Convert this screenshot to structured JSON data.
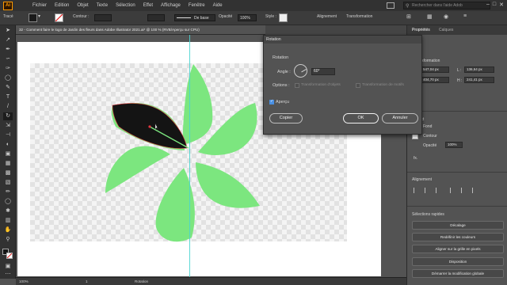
{
  "app": {
    "logo": "Ai"
  },
  "menu": [
    "Fichier",
    "Edition",
    "Objet",
    "Texte",
    "Sélection",
    "Effet",
    "Affichage",
    "Fenêtre",
    "Aide"
  ],
  "search": {
    "placeholder": "Rechercher dans l'aide Adob"
  },
  "controlbar": {
    "type_label": "Tracé",
    "contour_label": "Contour :",
    "stroke_style": "De base",
    "opacity_label": "Opacité",
    "opacity_value": "100%",
    "style_label": "Style :",
    "alignement_label": "Alignement",
    "transformation_label": "Transformation"
  },
  "document": {
    "tab_title": "32 - Comment faire le logo de Jardin des fleurs dans Adobe Illustrator 2021.ai* @ 100 % (RVB/Aperçu sur CPU)"
  },
  "status": {
    "zoom": "100%",
    "page": "1",
    "tool": "Rotation"
  },
  "dialog": {
    "title": "Rotation",
    "section": "Rotation",
    "angle_label": "Angle :",
    "angle_value": "60°",
    "options_label": "Options :",
    "opt_objects": "Transformation d'objets",
    "opt_patterns": "Transformation de motifs",
    "preview_label": "Aperçu",
    "preview_checked": true,
    "copy_button": "Copier",
    "ok_button": "OK",
    "cancel_button": "Annuler"
  },
  "panel": {
    "tabs": [
      "Propriétés",
      "Calques"
    ],
    "transform_heading": "Transformation",
    "x_label": "X :",
    "x_value": "547,04 px",
    "y_label": "Y :",
    "y_value": "404,70 px",
    "l_label": "L :",
    "l_value": "136,64 px",
    "h_label": "H :",
    "h_value": "241,41 px",
    "appearance_heading": "Aspect",
    "fond_label": "Fond",
    "contour_label": "Contour",
    "opacite_label": "Opacité",
    "opacite_value": "100%",
    "fx_label": "fx.",
    "alignment_heading": "Alignement",
    "quick_heading": "Sélections rapides",
    "quick_buttons": [
      "Décalage",
      "Redéfinir les couleurs",
      "Aligner sur la grille en pixels",
      "Disposition",
      "Démarrer la modification globale"
    ]
  },
  "colors": {
    "leaf": "#7ce67f",
    "selected_leaf": "#141414",
    "accent": "#ff9a00",
    "guide": "#4ad4d0"
  }
}
